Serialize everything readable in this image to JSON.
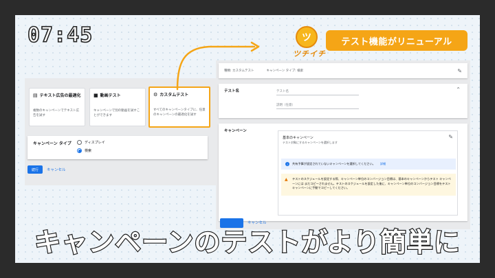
{
  "clock": "07:45",
  "logo": {
    "glyph": "ツ",
    "text": "ツチイチ"
  },
  "banner": "テスト機能がリニューアル",
  "left_panel": {
    "cards": [
      {
        "title": "テキスト広告の最適化",
        "icon": "text-ad-icon",
        "desc": "複数のキャンペーンでテキスト広告を試す"
      },
      {
        "title": "動画テスト",
        "icon": "video-icon",
        "desc": "キャンペーンで別の動画を試すことができます"
      },
      {
        "title": "カスタムテスト",
        "icon": "gear-icon",
        "desc": "すべてのキャンペーンタイプに、任意のキャンペーンの最適化を試す"
      }
    ],
    "campaign_type_label": "キャンペーン タイプ",
    "radio_options": [
      "ディスプレイ",
      "検索"
    ],
    "selected_option": "検索",
    "continue_label": "続行",
    "cancel_label": "キャンセル"
  },
  "right_panel": {
    "header_type": "種類: カスタムテスト",
    "header_campaign_type": "キャンペーン タイプ: 検索",
    "test_name_label": "テスト名",
    "test_name_placeholder": "テスト名",
    "description_placeholder": "説明（任意）",
    "campaign_label": "キャンペーン",
    "base_campaign_title": "基本のキャンペーン",
    "base_campaign_sub": "テスト対象にするキャンペーンを選択します",
    "info_text": "共有予算が設定されていないキャンペーンを選択してください。",
    "info_link": "詳細",
    "warning_text": "テストのスケジュールを設定する際、キャンペーン単位のコンバージョン目標は、基本のキャンペーンからテスト キャンペーンには まだコピーされません。テストのスケジュールを設定した後に、キャンペーン単位のコンバージョン目標をテスト キャンペーンに手動でコピーしてください。",
    "bottom_cancel": "キャンセル"
  },
  "caption": "キャンペーンのテストがより簡単に",
  "colors": {
    "accent": "#f5a516",
    "primary": "#1a73e8"
  }
}
